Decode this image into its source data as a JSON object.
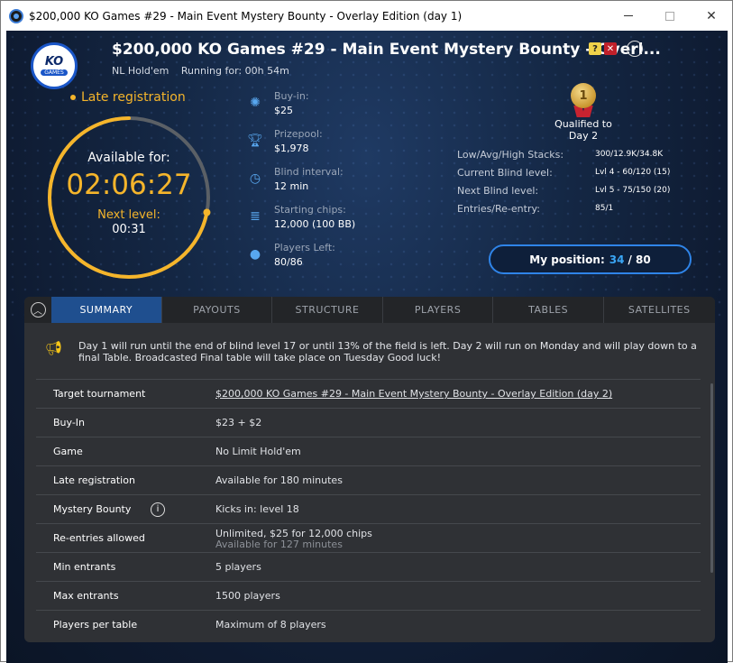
{
  "window": {
    "title": "$200,000 KO Games #29 - Main Event Mystery Bounty - Overlay Edition (day 1)"
  },
  "header": {
    "logo_text": "KO",
    "logo_sub": "GAMES",
    "title": "$200,000 KO Games #29 - Main Event Mystery Bounty - Overl...",
    "badge_q": "?",
    "badge_x": "✕",
    "game_type": "NL Hold'em",
    "running": "Running for: 00h 54m"
  },
  "timer": {
    "late_reg": "Late registration",
    "available_label": "Available for:",
    "available_value": "02:06:27",
    "next_label": "Next level:",
    "next_value": "00:31",
    "progress_fraction": 0.72
  },
  "stats": [
    {
      "label": "Buy-in:",
      "value": "$25",
      "icon": "chip-icon"
    },
    {
      "label": "Prizepool:",
      "value": "$1,978",
      "icon": "trophy-icon"
    },
    {
      "label": "Blind interval:",
      "value": "12 min",
      "icon": "clock-icon"
    },
    {
      "label": "Starting chips:",
      "value": "12,000 (100 BB)",
      "icon": "chips-stack-icon"
    },
    {
      "label": "Players Left:",
      "value": "80/86",
      "icon": "person-icon"
    }
  ],
  "qualification": {
    "medal": "1",
    "label": "Qualified to Day 2"
  },
  "info_table": [
    {
      "key": "Low/Avg/High Stacks:",
      "value": "300/12.9K/34.8K"
    },
    {
      "key": "Current Blind level:",
      "value": "Lvl 4 - 60/120 (15)"
    },
    {
      "key": "Next Blind level:",
      "value": "Lvl 5 - 75/150 (20)"
    },
    {
      "key": "Entries/Re-entry:",
      "value": "85/1"
    }
  ],
  "position": {
    "label": "My position:",
    "value": "34",
    "total": "/ 80"
  },
  "tabs": [
    "SUMMARY",
    "PAYOUTS",
    "STRUCTURE",
    "PLAYERS",
    "TABLES",
    "SATELLITES"
  ],
  "notice": "Day 1 will run until the end of blind level 17 or until 13% of the field is left. Day 2 will run on Monday and will play down to a final Table. Broadcasted Final table will take place on Tuesday Good luck!",
  "details": [
    {
      "key": "Target tournament",
      "value": "$200,000 KO Games #29 - Main Event Mystery Bounty - Overlay Edition (day 2)"
    },
    {
      "key": "Buy-In",
      "value": "$23 + $2"
    },
    {
      "key": "Game",
      "value": "No Limit Hold'em"
    },
    {
      "key": "Late registration",
      "value": "Available for 180 minutes"
    },
    {
      "key": "Mystery Bounty",
      "value": "Kicks in: level 18"
    },
    {
      "key": "Re-entries allowed",
      "value": "Unlimited, $25 for 12,000 chips",
      "sub": "Available for 127 minutes"
    },
    {
      "key": "Min entrants",
      "value": "5 players"
    },
    {
      "key": "Max entrants",
      "value": "1500 players"
    },
    {
      "key": "Players per table",
      "value": "Maximum of 8 players"
    }
  ],
  "colors": {
    "accent": "#f5b52b",
    "blue": "#2f84e8",
    "tab_active": "#1f4f8f"
  }
}
